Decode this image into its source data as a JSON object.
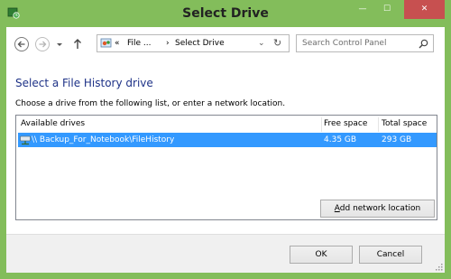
{
  "window": {
    "title": "Select Drive",
    "controls": {
      "minimize": "—",
      "maximize": "☐",
      "close": "✕"
    }
  },
  "nav": {
    "address_prefix": "«",
    "address_part1": "File ...",
    "address_sep": "›",
    "address_part2": "Select Drive",
    "address_dropdown": "⌄",
    "refresh": "↻",
    "search_placeholder": "Search Control Panel"
  },
  "main": {
    "heading": "Select a File History drive",
    "instructions": "Choose a drive from the following list, or enter a network location."
  },
  "list": {
    "columns": [
      "Available drives",
      "Free space",
      "Total space"
    ],
    "rows": [
      {
        "name": "\\\\                                    Backup_For_Notebook\\FileHistory",
        "free": "4.35 GB",
        "total": "293 GB",
        "selected": true
      }
    ]
  },
  "buttons": {
    "add_network": "Add network location",
    "add_network_mnemonic": "A",
    "add_network_rest": "dd network location",
    "ok": "OK",
    "cancel": "Cancel"
  },
  "colors": {
    "frame": "#83bd5b",
    "close": "#c75050",
    "selection": "#3399ff",
    "heading": "#1e3287"
  }
}
